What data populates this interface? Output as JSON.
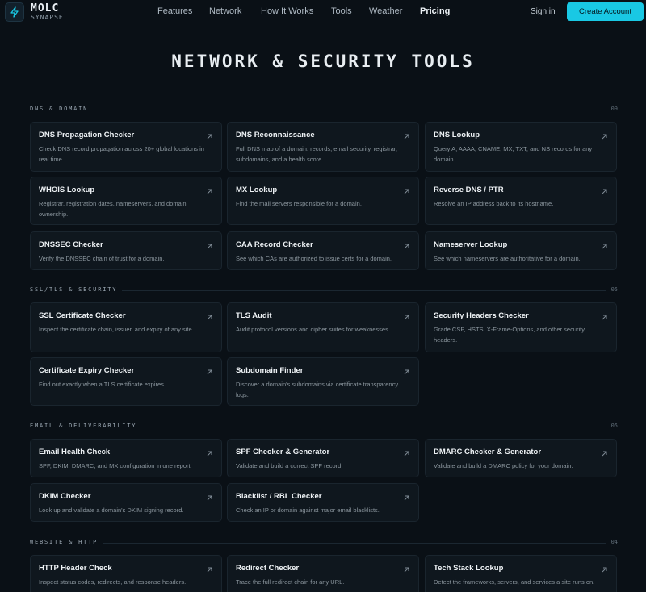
{
  "brand": {
    "line1": "MOLC",
    "line2": "SYNAPSE"
  },
  "nav": {
    "links": [
      "Features",
      "Network",
      "How It Works",
      "Tools",
      "Weather",
      "Pricing"
    ],
    "signin": "Sign in",
    "cta": "Create Account"
  },
  "page_title": "NETWORK & SECURITY TOOLS",
  "sections": [
    {
      "label": "DNS & DOMAIN",
      "count": "09",
      "tools": [
        {
          "title": "DNS Propagation Checker",
          "desc": "Check DNS record propagation across 20+ global locations in real time."
        },
        {
          "title": "DNS Reconnaissance",
          "desc": "Full DNS map of a domain: records, email security, registrar, subdomains, and a health score."
        },
        {
          "title": "DNS Lookup",
          "desc": "Query A, AAAA, CNAME, MX, TXT, and NS records for any domain."
        },
        {
          "title": "WHOIS Lookup",
          "desc": "Registrar, registration dates, nameservers, and domain ownership."
        },
        {
          "title": "MX Lookup",
          "desc": "Find the mail servers responsible for a domain."
        },
        {
          "title": "Reverse DNS / PTR",
          "desc": "Resolve an IP address back to its hostname."
        },
        {
          "title": "DNSSEC Checker",
          "desc": "Verify the DNSSEC chain of trust for a domain."
        },
        {
          "title": "CAA Record Checker",
          "desc": "See which CAs are authorized to issue certs for a domain."
        },
        {
          "title": "Nameserver Lookup",
          "desc": "See which nameservers are authoritative for a domain."
        }
      ]
    },
    {
      "label": "SSL/TLS & SECURITY",
      "count": "05",
      "tools": [
        {
          "title": "SSL Certificate Checker",
          "desc": "Inspect the certificate chain, issuer, and expiry of any site."
        },
        {
          "title": "TLS Audit",
          "desc": "Audit protocol versions and cipher suites for weaknesses."
        },
        {
          "title": "Security Headers Checker",
          "desc": "Grade CSP, HSTS, X-Frame-Options, and other security headers."
        },
        {
          "title": "Certificate Expiry Checker",
          "desc": "Find out exactly when a TLS certificate expires."
        },
        {
          "title": "Subdomain Finder",
          "desc": "Discover a domain's subdomains via certificate transparency logs."
        }
      ]
    },
    {
      "label": "EMAIL & DELIVERABILITY",
      "count": "05",
      "tools": [
        {
          "title": "Email Health Check",
          "desc": "SPF, DKIM, DMARC, and MX configuration in one report."
        },
        {
          "title": "SPF Checker & Generator",
          "desc": "Validate and build a correct SPF record."
        },
        {
          "title": "DMARC Checker & Generator",
          "desc": "Validate and build a DMARC policy for your domain."
        },
        {
          "title": "DKIM Checker",
          "desc": "Look up and validate a domain's DKIM signing record."
        },
        {
          "title": "Blacklist / RBL Checker",
          "desc": "Check an IP or domain against major email blacklists."
        }
      ]
    },
    {
      "label": "WEBSITE & HTTP",
      "count": "04",
      "tools": [
        {
          "title": "HTTP Header Check",
          "desc": "Inspect status codes, redirects, and response headers."
        },
        {
          "title": "Redirect Checker",
          "desc": "Trace the full redirect chain for any URL."
        },
        {
          "title": "Tech Stack Lookup",
          "desc": "Detect the frameworks, servers, and services a site runs on."
        }
      ]
    }
  ],
  "colors": {
    "accent": "#19c8e4",
    "background": "#0a1016",
    "card": "#0f171e"
  },
  "icons": {
    "logo": "bolt-icon",
    "card_link": "arrow-up-right-icon"
  }
}
